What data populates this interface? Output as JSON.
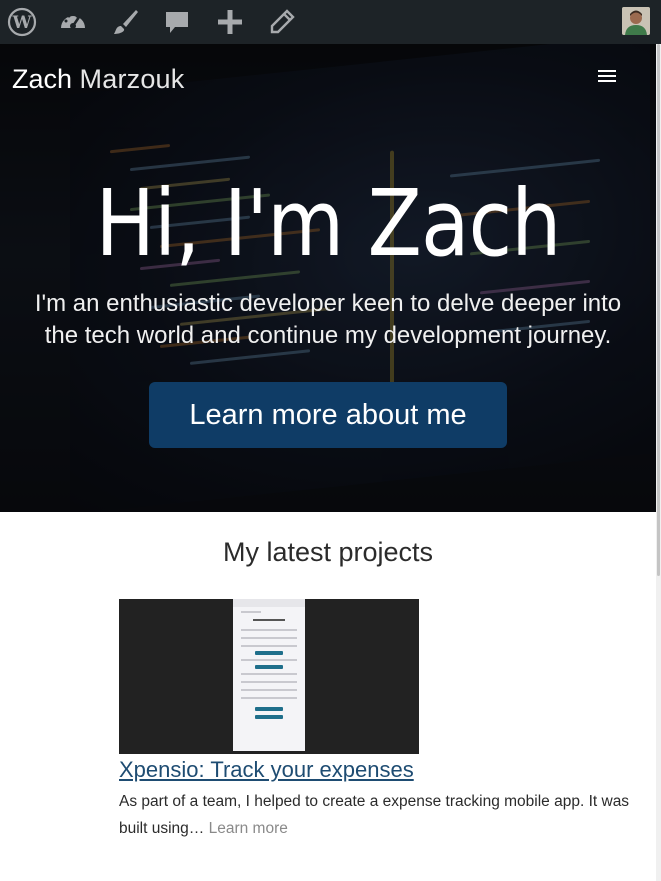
{
  "admin_bar": {
    "items": [
      "wordpress-icon",
      "dashboard-icon",
      "customize-icon",
      "comments-icon",
      "new-content-icon",
      "edit-icon"
    ],
    "bg_color": "#1d2327",
    "icon_color": "#a7aaad"
  },
  "site": {
    "brand_first": "Zach",
    "brand_last": "Marzouk"
  },
  "hero": {
    "title": "Hi, I'm Zach",
    "subtitle": "I'm an enthusiastic developer keen to delve deeper into the tech world and continue my development journey.",
    "cta_label": "Learn more about me",
    "cta_color": "#0f3c66"
  },
  "projects": {
    "heading": "My latest projects",
    "items": [
      {
        "title": "Xpensio: Track your expenses",
        "excerpt": "As part of a team, I helped to create a expense tracking mobile app. It was built using…",
        "read_more": "Learn more"
      }
    ]
  }
}
